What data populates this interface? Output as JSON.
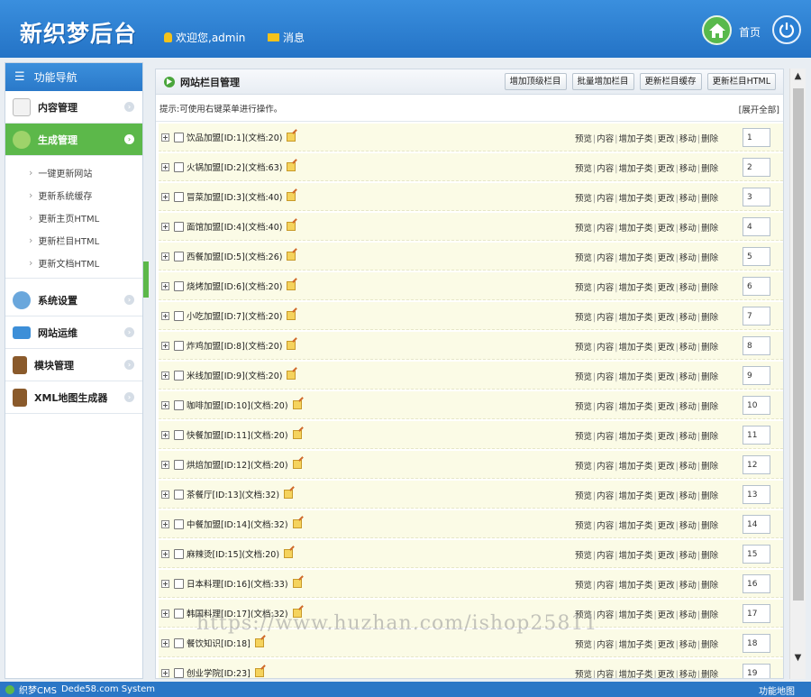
{
  "header": {
    "logo": "新织梦后台",
    "welcome": "欢迎您,admin",
    "messages": "消息",
    "home": "首页"
  },
  "sidebar": {
    "title": "功能导航",
    "items": [
      {
        "label": "内容管理",
        "icon": "edit-icon"
      },
      {
        "label": "生成管理",
        "icon": "tree-icon",
        "active": true
      },
      {
        "label": "系统设置",
        "icon": "gear-icon"
      },
      {
        "label": "网站运维",
        "icon": "monitor-icon"
      },
      {
        "label": "模块管理",
        "icon": "book-icon"
      },
      {
        "label": "XML地图生成器",
        "icon": "book-icon"
      }
    ],
    "subitems": [
      "一键更新网站",
      "更新系统缓存",
      "更新主页HTML",
      "更新栏目HTML",
      "更新文档HTML"
    ]
  },
  "panel": {
    "title": "网站栏目管理",
    "buttons": [
      "增加顶级栏目",
      "批量增加栏目",
      "更新栏目缓存",
      "更新栏目HTML"
    ],
    "tip": "提示:可使用右键菜单进行操作。",
    "expand_all": "[展开全部]",
    "ops": [
      "预览",
      "内容",
      "增加子类",
      "更改",
      "移动",
      "删除"
    ],
    "rows": [
      {
        "name": "饮品加盟[ID:1](文档:20)",
        "order": "1"
      },
      {
        "name": "火锅加盟[ID:2](文档:63)",
        "order": "2"
      },
      {
        "name": "冒菜加盟[ID:3](文档:40)",
        "order": "3"
      },
      {
        "name": "面馆加盟[ID:4](文档:40)",
        "order": "4"
      },
      {
        "name": "西餐加盟[ID:5](文档:26)",
        "order": "5"
      },
      {
        "name": "烧烤加盟[ID:6](文档:20)",
        "order": "6"
      },
      {
        "name": "小吃加盟[ID:7](文档:20)",
        "order": "7"
      },
      {
        "name": "炸鸡加盟[ID:8](文档:20)",
        "order": "8"
      },
      {
        "name": "米线加盟[ID:9](文档:20)",
        "order": "9"
      },
      {
        "name": "咖啡加盟[ID:10](文档:20)",
        "order": "10"
      },
      {
        "name": "快餐加盟[ID:11](文档:20)",
        "order": "11"
      },
      {
        "name": "烘焙加盟[ID:12](文档:20)",
        "order": "12"
      },
      {
        "name": "茶餐厅[ID:13](文档:32)",
        "order": "13"
      },
      {
        "name": "中餐加盟[ID:14](文档:32)",
        "order": "14"
      },
      {
        "name": "麻辣烫[ID:15](文档:20)",
        "order": "15"
      },
      {
        "name": "日本料理[ID:16](文档:33)",
        "order": "16"
      },
      {
        "name": "韩国料理[ID:17](文档:32)",
        "order": "17"
      },
      {
        "name": "餐饮知识[ID:18]",
        "order": "18"
      },
      {
        "name": "创业学院[ID:23]",
        "order": "19"
      }
    ]
  },
  "watermark": "https://www.huzhan.com/ishop25811",
  "footer": {
    "brand": "织梦CMS",
    "system": "Dede58.com System",
    "sitemap": "功能地图"
  }
}
